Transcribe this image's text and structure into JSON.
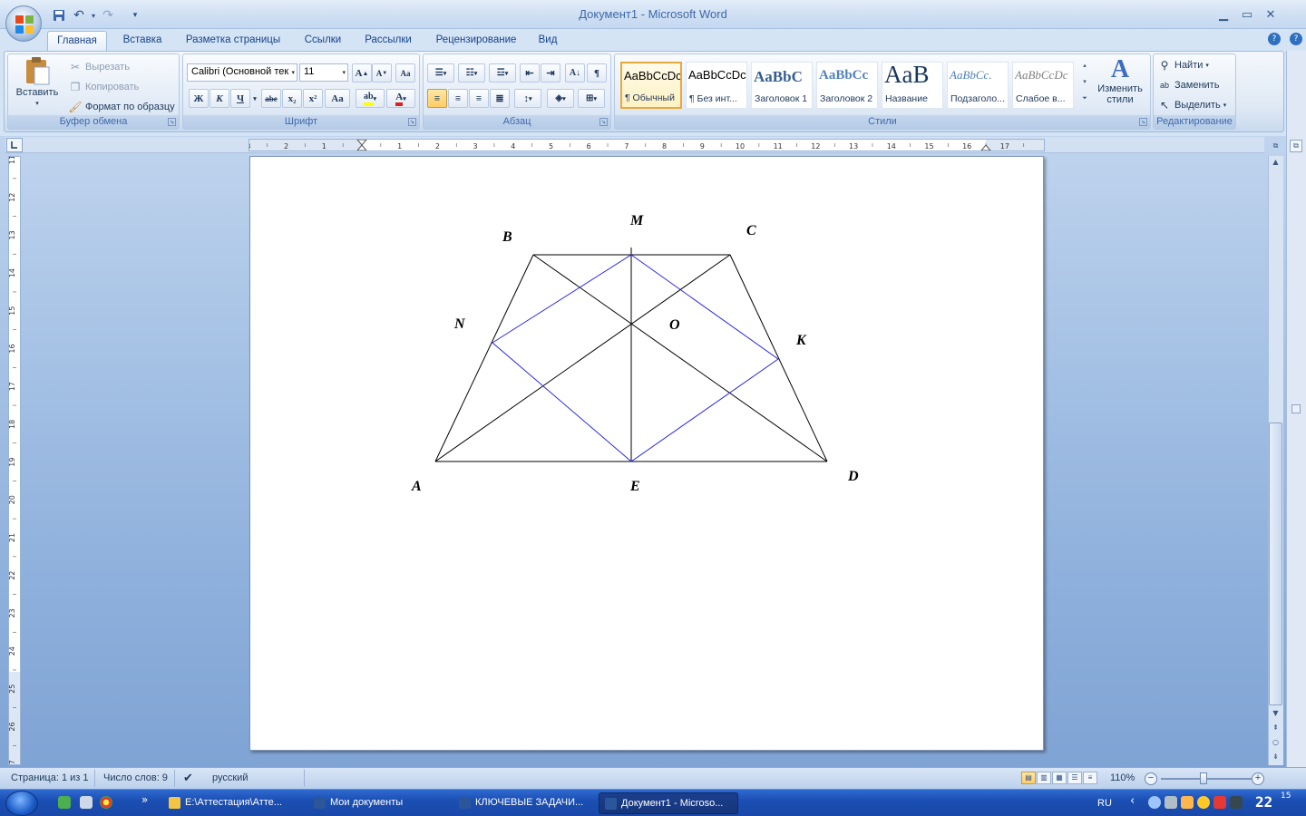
{
  "window": {
    "title": "Документ1 - Microsoft Word"
  },
  "tabs": [
    "Главная",
    "Вставка",
    "Разметка страницы",
    "Ссылки",
    "Рассылки",
    "Рецензирование",
    "Вид"
  ],
  "clipboard": {
    "paste": "Вставить",
    "cut": "Вырезать",
    "copy": "Копировать",
    "format_painter": "Формат по образцу",
    "label": "Буфер обмена"
  },
  "font": {
    "name": "Calibri (Основной тек",
    "size": "11",
    "label": "Шрифт",
    "bold": "Ж",
    "italic": "К",
    "underline": "Ч",
    "strike": "abe",
    "sub": "x₂",
    "sup": "x²",
    "case": "Aa"
  },
  "paragraph": {
    "label": "Абзац",
    "pilcrow": "¶"
  },
  "styles": {
    "label": "Стили",
    "items": [
      {
        "sample": "AaBbCcDc",
        "name": "¶ Обычный"
      },
      {
        "sample": "AaBbCcDc",
        "name": "¶ Без инт..."
      },
      {
        "sample": "AaBbC",
        "name": "Заголовок 1"
      },
      {
        "sample": "AaBbCc",
        "name": "Заголовок 2"
      },
      {
        "sample": "AaB",
        "name": "Название"
      },
      {
        "sample": "AaBbCc.",
        "name": "Подзаголо..."
      },
      {
        "sample": "AaBbCcDc",
        "name": "Слабое в..."
      }
    ],
    "change_line1": "Изменить",
    "change_line2": "стили"
  },
  "editing": {
    "label": "Редактирование",
    "find": "Найти",
    "replace": "Заменить",
    "select": "Выделить"
  },
  "ruler": {
    "h_labels": [
      "3",
      "2",
      "1",
      "1",
      "2",
      "3",
      "4",
      "5",
      "6",
      "7",
      "8",
      "9",
      "10",
      "11",
      "12",
      "13",
      "14",
      "15",
      "16",
      "17"
    ],
    "v_labels": [
      "11",
      "12",
      "13",
      "14",
      "15",
      "16",
      "17",
      "18",
      "19",
      "20",
      "21",
      "22",
      "23",
      "24",
      "25",
      "26",
      "27"
    ]
  },
  "diagram": {
    "labels": {
      "A": "A",
      "B": "B",
      "C": "C",
      "D": "D",
      "M": "M",
      "N": "N",
      "O": "O",
      "K": "K",
      "E": "E"
    },
    "colors": {
      "black_lines": "#000000",
      "blue_lines": "#2626e6"
    }
  },
  "status": {
    "page": "Страница: 1 из 1",
    "words": "Число слов: 9",
    "language": "русский",
    "zoom": "110%"
  },
  "taskbar": {
    "tasks": [
      "E:\\Аттестация\\Атте...",
      "Мои документы",
      "КЛЮЧЕВЫЕ ЗАДАЧИ...",
      "Документ1 - Microso..."
    ],
    "lang": "RU",
    "clock_hour": "22",
    "clock_min": "15"
  }
}
